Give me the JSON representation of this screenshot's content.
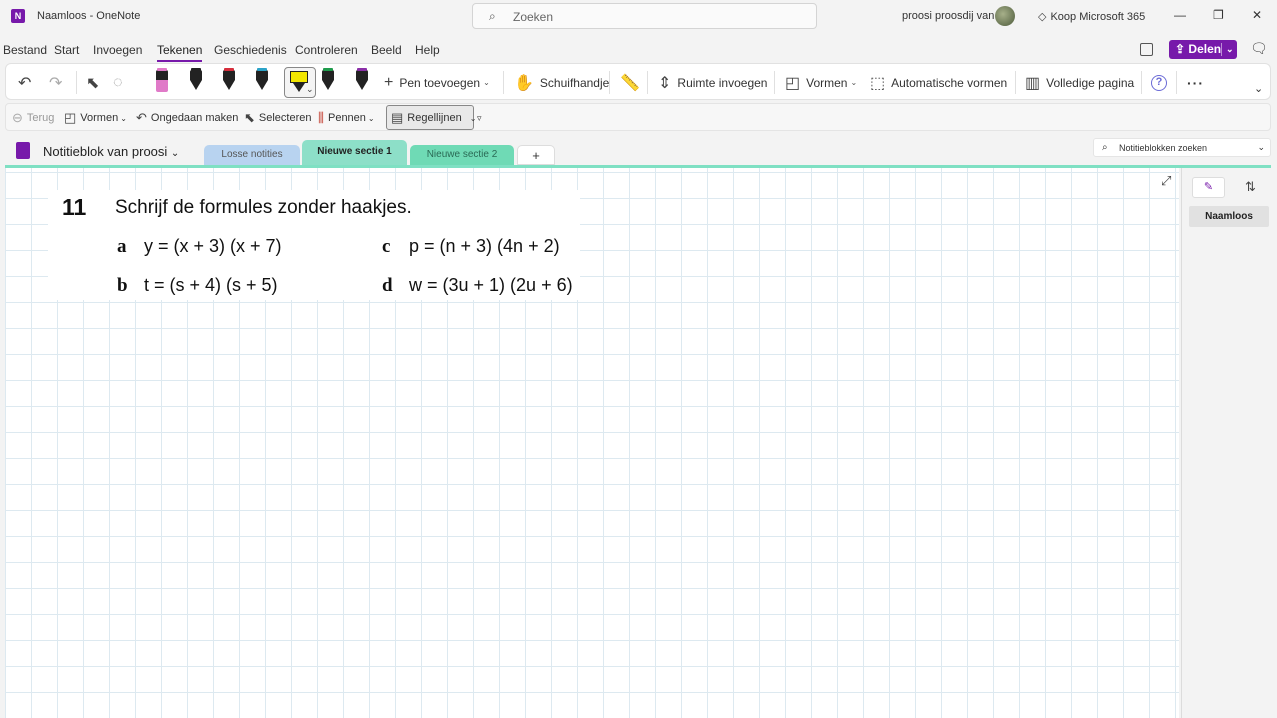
{
  "titlebar": {
    "app_name": "OneNote",
    "window_title": "Naamloos  -  OneNote",
    "search_placeholder": "Zoeken",
    "user_name": "proosi proosdij van",
    "buy_label": "Koop Microsoft 365",
    "window_controls": [
      "minimize-icon",
      "restore-icon",
      "close-icon"
    ]
  },
  "menu": {
    "items": [
      "Bestand",
      "Start",
      "Invoegen",
      "Tekenen",
      "Geschiedenis",
      "Controleren",
      "Beeld",
      "Help"
    ],
    "active": "Tekenen",
    "share_label": "Delen"
  },
  "ribbon": {
    "add_pen": "Pen toevoegen",
    "pan": "Schuifhandje",
    "insert_space": "Ruimte invoegen",
    "shapes": "Vormen",
    "auto_shapes": "Automatische vormen",
    "full_page": "Volledige pagina",
    "help_glyph": "?",
    "more_glyph": "···",
    "pens": [
      {
        "color": "#e07ac8",
        "type": "marker"
      },
      {
        "color": "#222222",
        "type": "pen"
      },
      {
        "color": "#d62e3c",
        "type": "pen"
      },
      {
        "color": "#2ba3c8",
        "type": "pen"
      },
      {
        "color": "#f2e600",
        "type": "highlighter",
        "selected": true
      },
      {
        "color": "#1f9c4c",
        "type": "pen"
      },
      {
        "color": "#8b2fa8",
        "type": "pen"
      }
    ]
  },
  "subtoolbar": {
    "back": "Terug",
    "shapes": "Vormen",
    "undo": "Ongedaan maken",
    "select": "Selecteren",
    "pens": "Pennen",
    "rule_lines": "Regellijnen"
  },
  "notebook": {
    "title": "Notitieblok van proosi",
    "search_placeholder": "Notitieblokken zoeken",
    "tabs": [
      "Losse notities",
      "Nieuwe sectie 1",
      "Nieuwe sectie 2"
    ],
    "active_tab": "Nieuwe sectie 1",
    "add_tab": "+"
  },
  "exercise": {
    "number": "11",
    "title": "Schrijf de formules zonder haakjes.",
    "items": [
      {
        "label": "a",
        "formula": "y = (x + 3) (x + 7)"
      },
      {
        "label": "b",
        "formula": "t = (s + 4) (s + 5)"
      },
      {
        "label": "c",
        "formula": "p = (n + 3) (4n + 2)"
      },
      {
        "label": "d",
        "formula": "w = (3u + 1) (2u + 6)"
      }
    ]
  },
  "pages_pane": {
    "pages": [
      "Naamloos"
    ],
    "active_page": "Naamloos"
  },
  "colors": {
    "accent": "#7719aa",
    "section_tab_active": "#8ddfc8",
    "grid_line": "#dde9f0"
  }
}
